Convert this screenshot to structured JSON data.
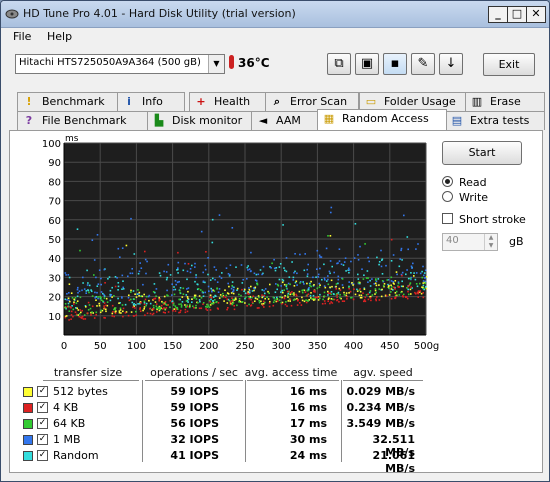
{
  "window": {
    "title": "HD Tune Pro 4.01 - Hard Disk Utility (trial version)"
  },
  "menu": {
    "file": "File",
    "help": "Help"
  },
  "toolbar": {
    "drive": "Hitachi HTS725050A9A364 (500 gB)",
    "temperature": "36°C",
    "exit_label": "Exit"
  },
  "tabs_row1": [
    {
      "label": "Benchmark",
      "icon": "!"
    },
    {
      "label": "Info",
      "icon": "i"
    },
    {
      "label": "Health",
      "icon": "+"
    },
    {
      "label": "Error Scan",
      "icon": "⌕"
    },
    {
      "label": "Folder Usage",
      "icon": "▭"
    },
    {
      "label": "Erase",
      "icon": "▥"
    }
  ],
  "tabs_row2": [
    {
      "label": "File Benchmark",
      "icon": "?"
    },
    {
      "label": "Disk monitor",
      "icon": "▙"
    },
    {
      "label": "AAM",
      "icon": "◄"
    },
    {
      "label": "Random Access",
      "icon": "▦"
    },
    {
      "label": "Extra tests",
      "icon": "▤"
    }
  ],
  "controls": {
    "start": "Start",
    "read": "Read",
    "write": "Write",
    "short_stroke": "Short stroke",
    "gb_value": "40",
    "gb_unit": "gB"
  },
  "results": {
    "headers": [
      "transfer size",
      "operations / sec",
      "avg. access time",
      "agv. speed"
    ],
    "rows": [
      {
        "size": "512 bytes",
        "iops": "59 IOPS",
        "access": "16 ms",
        "speed": "0.029 MB/s",
        "color": "#ffff33"
      },
      {
        "size": "4 KB",
        "iops": "59 IOPS",
        "access": "16 ms",
        "speed": "0.234 MB/s",
        "color": "#dd2222"
      },
      {
        "size": "64 KB",
        "iops": "56 IOPS",
        "access": "17 ms",
        "speed": "3.549 MB/s",
        "color": "#33cc33"
      },
      {
        "size": "1 MB",
        "iops": "32 IOPS",
        "access": "30 ms",
        "speed": "32.511 MB/s",
        "color": "#3377ee"
      },
      {
        "size": "Random",
        "iops": "41 IOPS",
        "access": "24 ms",
        "speed": "21.061 MB/s",
        "color": "#33dddd"
      }
    ]
  },
  "chart_data": {
    "type": "scatter",
    "ylabel": "ms",
    "xlim": [
      0,
      500
    ],
    "ylim": [
      0,
      100
    ],
    "x_ticks": [
      "0",
      "50",
      "100",
      "150",
      "200",
      "250",
      "300",
      "350",
      "400",
      "450",
      "500gB"
    ],
    "y_ticks": [
      "10",
      "20",
      "30",
      "40",
      "50",
      "60",
      "70",
      "80",
      "90",
      "100"
    ],
    "grid": true,
    "series": [
      {
        "name": "512 bytes",
        "color": "#ffff33",
        "x_range": [
          0,
          500
        ],
        "y_min": [
          10,
          22
        ],
        "y_max": [
          22,
          32
        ]
      },
      {
        "name": "4 KB",
        "color": "#dd2222",
        "x_range": [
          0,
          500
        ],
        "y_min": [
          8,
          20
        ],
        "y_max": [
          17,
          27
        ]
      },
      {
        "name": "64 KB",
        "color": "#33cc33",
        "x_range": [
          0,
          500
        ],
        "y_min": [
          10,
          22
        ],
        "y_max": [
          22,
          32
        ]
      },
      {
        "name": "1 MB",
        "color": "#3377ee",
        "x_range": [
          0,
          500
        ],
        "y_min": [
          18,
          28
        ],
        "y_max": [
          40,
          48
        ]
      },
      {
        "name": "Random",
        "color": "#33dddd",
        "x_range": [
          0,
          500
        ],
        "y_min": [
          14,
          24
        ],
        "y_max": [
          34,
          42
        ]
      }
    ]
  }
}
